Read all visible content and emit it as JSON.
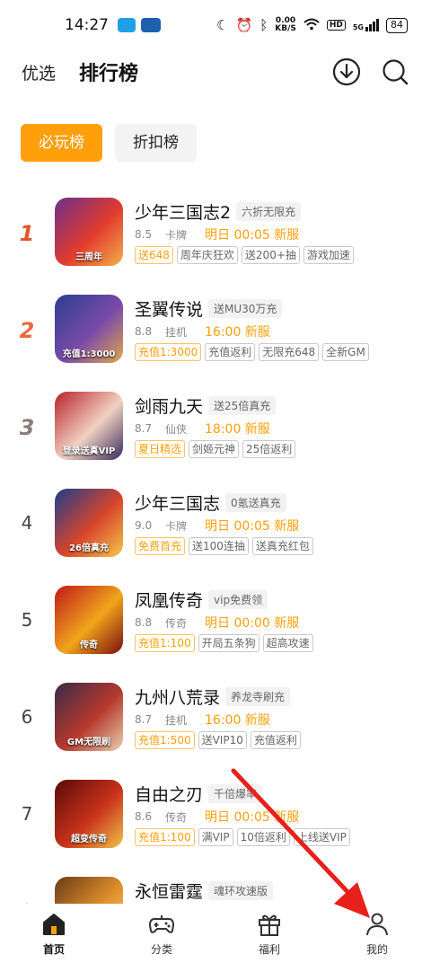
{
  "status_bar": {
    "time": "14:27",
    "net_speed_value": "0.00",
    "net_speed_unit": "KB/S",
    "hd": "HD",
    "signal": "5G",
    "battery": "84"
  },
  "header": {
    "tab_pick": "优选",
    "tab_rank": "排行榜"
  },
  "segments": {
    "must_play": "必玩榜",
    "discount": "折扣榜"
  },
  "games": [
    {
      "rank": "1",
      "name": "少年三国志2",
      "promo": "六折无限充",
      "score": "8.5",
      "genre": "卡牌",
      "server": "明日 00:05 新服",
      "cover_text": "三周年",
      "colors": [
        "#6b2f8a",
        "#e23b2e",
        "#f2b04a"
      ],
      "tags": [
        {
          "text": "送648",
          "hl": true
        },
        {
          "text": "周年庆狂欢",
          "hl": false
        },
        {
          "text": "送200+抽",
          "hl": false
        },
        {
          "text": "游戏加速",
          "hl": false
        }
      ]
    },
    {
      "rank": "2",
      "name": "圣翼传说",
      "promo": "送MU30万充",
      "score": "8.8",
      "genre": "挂机",
      "server": "16:00 新服",
      "cover_text": "充值1:3000",
      "colors": [
        "#2a3f8f",
        "#7a4aa8",
        "#e0a74a"
      ],
      "tags": [
        {
          "text": "充值1:3000",
          "hl": true
        },
        {
          "text": "充值返利",
          "hl": false
        },
        {
          "text": "无限充648",
          "hl": false
        },
        {
          "text": "全新GM",
          "hl": false
        }
      ]
    },
    {
      "rank": "3",
      "name": "剑雨九天",
      "promo": "送25倍真充",
      "score": "8.7",
      "genre": "仙侠",
      "server": "18:00 新服",
      "cover_text": "登录送真VIP",
      "colors": [
        "#b8212a",
        "#f1d2c2",
        "#3a2a5a"
      ],
      "tags": [
        {
          "text": "夏日精选",
          "hl": true
        },
        {
          "text": "剑姬元神",
          "hl": false
        },
        {
          "text": "25倍返利",
          "hl": false
        }
      ]
    },
    {
      "rank": "4",
      "name": "少年三国志",
      "promo": "0氪送真充",
      "score": "9.0",
      "genre": "卡牌",
      "server": "明日 00:05 新服",
      "cover_text": "26倍真充",
      "colors": [
        "#1e3d8a",
        "#d8452a",
        "#f5c84a"
      ],
      "tags": [
        {
          "text": "免费首充",
          "hl": true
        },
        {
          "text": "送100连抽",
          "hl": false
        },
        {
          "text": "送真充红包",
          "hl": false
        }
      ]
    },
    {
      "rank": "5",
      "name": "凤凰传奇",
      "promo": "vip免费领",
      "score": "8.8",
      "genre": "传奇",
      "server": "明日 00:00 新服",
      "cover_text": "传奇",
      "colors": [
        "#c01818",
        "#f0a51c",
        "#7a0d0d"
      ],
      "tags": [
        {
          "text": "充值1:100",
          "hl": true
        },
        {
          "text": "开局五条狗",
          "hl": false
        },
        {
          "text": "超高攻速",
          "hl": false
        }
      ]
    },
    {
      "rank": "6",
      "name": "九州八荒录",
      "promo": "养龙寺刷充",
      "score": "8.7",
      "genre": "挂机",
      "server": "16:00 新服",
      "cover_text": "GM无限刷",
      "colors": [
        "#3a2a4a",
        "#b63a2c",
        "#e8d0b0"
      ],
      "tags": [
        {
          "text": "充值1:500",
          "hl": true
        },
        {
          "text": "送VIP10",
          "hl": false
        },
        {
          "text": "充值返利",
          "hl": false
        }
      ]
    },
    {
      "rank": "7",
      "name": "自由之刃",
      "promo": "千倍爆率",
      "score": "8.6",
      "genre": "传奇",
      "server": "明日 00:05 新服",
      "cover_text": "超变传奇",
      "colors": [
        "#5a0a0a",
        "#c8321a",
        "#f0c24a"
      ],
      "tags": [
        {
          "text": "充值1:100",
          "hl": true
        },
        {
          "text": "满VIP",
          "hl": false
        },
        {
          "text": "10倍返利",
          "hl": false
        },
        {
          "text": "上线送VIP",
          "hl": false
        }
      ]
    },
    {
      "rank": "8",
      "name": "永恒雷霆",
      "promo": "魂环攻速版",
      "score": "",
      "genre": "",
      "server": "",
      "cover_text": "",
      "colors": [
        "#6a3a1a",
        "#e0902a",
        "#f5d48a"
      ],
      "tags": []
    }
  ],
  "bottom_nav": [
    {
      "label": "首页",
      "icon": "home-icon",
      "active": true
    },
    {
      "label": "分类",
      "icon": "gamepad-icon",
      "active": false
    },
    {
      "label": "福利",
      "icon": "gift-icon",
      "active": false
    },
    {
      "label": "我的",
      "icon": "user-icon",
      "active": false
    }
  ],
  "colors": {
    "accent": "#ff9f0a",
    "annotation_arrow": "#e8201c"
  }
}
